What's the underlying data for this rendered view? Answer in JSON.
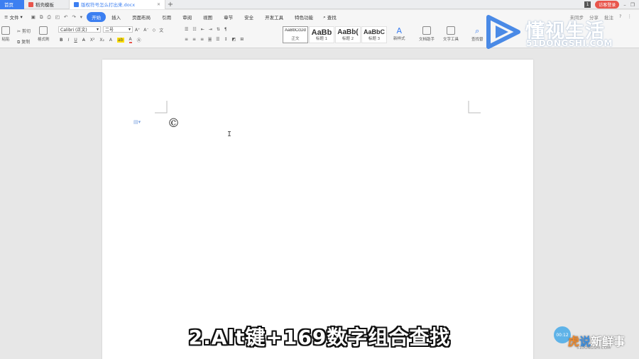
{
  "tabs": {
    "home": "首页",
    "template": "稻壳模板",
    "document": "版权符号怎么打出来.docx"
  },
  "title_right": {
    "count": "1",
    "login": "访客登录"
  },
  "menu": {
    "file": "文件",
    "items": [
      "开始",
      "插入",
      "页面布局",
      "引用",
      "审阅",
      "视图",
      "章节",
      "安全",
      "开发工具",
      "特色功能"
    ],
    "search": "查找",
    "right": [
      "未同步",
      "分享",
      "批注"
    ]
  },
  "ribbon": {
    "paste": "粘贴",
    "cut": "剪切",
    "copy": "复制",
    "format_painter": "格式刷",
    "font_name": "Calibri (正文)",
    "font_size": "二号",
    "styles": [
      {
        "sample": "AaBbCcDd",
        "name": "正文"
      },
      {
        "sample": "AaBb",
        "name": "标题 1"
      },
      {
        "sample": "AaBb(",
        "name": "标题 2"
      },
      {
        "sample": "AaBbC",
        "name": "标题 3"
      }
    ],
    "new_style": "新样式",
    "doc_assistant": "文档助手",
    "text_tools": "文字工具",
    "find_replace": "查找替"
  },
  "document": {
    "content": "©"
  },
  "subtitle": "2.Alt键+169数字组合查找",
  "watermark_top": {
    "name": "懂视生活",
    "domain": "51DONGSHI.COM"
  },
  "watermark_bottom": {
    "badge": "00:12",
    "hu": "虎",
    "shuo": "说",
    "rest": "新鲜事",
    "domain": "51DONGSHI.COM"
  },
  "colors": {
    "accent": "#3c7ff1",
    "login": "#e8554c",
    "logo_blue": "#4a8ae6"
  }
}
